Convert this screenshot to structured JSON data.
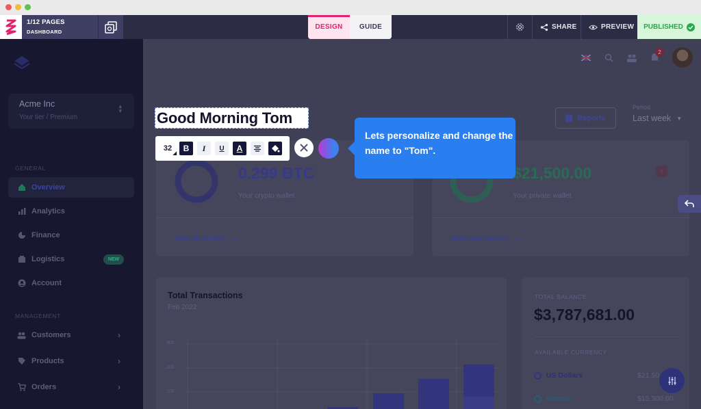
{
  "editor": {
    "pages": "1/12 PAGES",
    "page_name": "DASHBOARD",
    "tabs": [
      "DESIGN",
      "GUIDE"
    ],
    "share": "SHARE",
    "preview": "PREVIEW",
    "published": "PUBLISHED"
  },
  "sidebar": {
    "company": "Acme Inc",
    "tier": "Your tier / Premium",
    "section_general": "GENERAL",
    "general": [
      "Overview",
      "Analytics",
      "Finance",
      "Logistics",
      "Account"
    ],
    "new_badge": "NEW",
    "section_management": "MANAGEMENT",
    "management": [
      "Customers",
      "Products",
      "Orders"
    ]
  },
  "header": {
    "notifications": "2",
    "reports": "Reports",
    "period_label": "Period",
    "period_value": "Last week"
  },
  "greeting": "Good Morning Tom",
  "toolbar": {
    "font_size": "32",
    "bold": "B",
    "italic": "I",
    "underline": "U",
    "text_color": "A"
  },
  "tooltip": "Lets personalize and change the name to \"Tom\".",
  "wallet": {
    "value": "0.299 BTC",
    "label": "Your crypto wallet",
    "link": "See all activity"
  },
  "private": {
    "value": "$21,500.00",
    "label": "Your private wallet",
    "link": "Withdraw money"
  },
  "transactions": {
    "title": "Total Transactions",
    "date": "Feb 2022",
    "ticks": [
      "300",
      "200",
      "100"
    ]
  },
  "balance": {
    "label": "TOTAL BALANCE",
    "value": "$3,787,681.00",
    "currency_label": "AVAILABLE CURRENCY",
    "currencies": [
      {
        "name": "US Dollars",
        "value": "$21,50"
      },
      {
        "name": "Bitcoin",
        "value": "$15,300.00"
      }
    ]
  },
  "colors": {
    "editor_bar": "#2c2d45",
    "design_accent": "#e0246e",
    "published_green": "#27a84a",
    "tooltip_blue": "#2a7ff0"
  }
}
